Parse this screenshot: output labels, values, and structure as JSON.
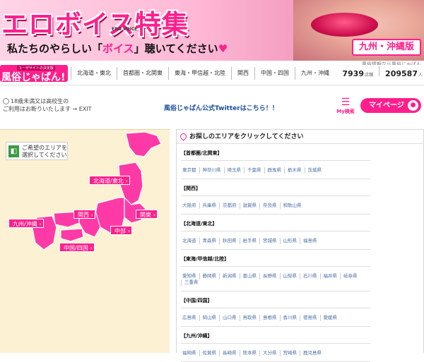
{
  "banner": {
    "title": "エロボイス特集",
    "voice_mark": "ERO VOICE",
    "subtitle_pre": "私たちのやらしい「",
    "subtitle_hl": "ボイス",
    "subtitle_post": "」聴いてください",
    "heart": "♥",
    "region": "九州・沖縄版"
  },
  "tagline": "風俗情報なら風俗じゃぱん",
  "logo": {
    "small": "ユーザサイトの決定版",
    "big": "風俗じゃぱん!"
  },
  "nav": {
    "links": [
      "北海道・東北",
      "首都圏・北関東",
      "東海・甲信越・北陸",
      "関西",
      "中国・四国",
      "九州・沖縄"
    ]
  },
  "counts": {
    "shops": "7939",
    "shops_unit": "店舗",
    "girls": "209587",
    "girls_unit": "人"
  },
  "age_note": {
    "line1": "18歳未満又は高校生の",
    "line2": "ご利用はお断りいたします → EXIT"
  },
  "twitter": "風俗じゃぱん公式Twitterはこちら！！",
  "my_search": "My検索",
  "my_page": "マイページ",
  "map": {
    "guide_line1": "ご希望のエリアを",
    "guide_line2": "選択してください",
    "labels": {
      "hokkaido": "北海道/東北",
      "kanto": "関東",
      "kansai": "関西",
      "chubu": "中部",
      "kyushu": "九州/沖縄",
      "chugoku": "中国/四国"
    }
  },
  "area_panel": {
    "heading": "お探しのエリアをクリックしてください",
    "groups": [
      {
        "title": "【首都圏/北関東】",
        "prefs": [
          "東京都",
          "神奈川県",
          "埼玉県",
          "千葉県",
          "群馬県",
          "栃木県",
          "茨城県"
        ]
      },
      {
        "title": "【関西】",
        "prefs": [
          "大阪府",
          "兵庫県",
          "京都府",
          "滋賀県",
          "奈良県",
          "和歌山県"
        ]
      },
      {
        "title": "【北海道/東北】",
        "prefs": [
          "北海道",
          "青森県",
          "秋田県",
          "岩手県",
          "宮城県",
          "山形県",
          "福島県"
        ]
      },
      {
        "title": "【東海/甲信越/北陸】",
        "prefs": [
          "愛知県",
          "静岡県",
          "新潟県",
          "富山県",
          "長野県",
          "山梨県",
          "石川県",
          "福井県",
          "岐阜県",
          "三重県"
        ]
      },
      {
        "title": "【中国/四国】",
        "prefs": [
          "広島県",
          "岡山県",
          "山口県",
          "鳥取県",
          "島根県",
          "香川県",
          "徳島県",
          "愛媛県"
        ]
      },
      {
        "title": "【九州/沖縄】",
        "prefs": [
          "福岡県",
          "佐賀県",
          "長崎県",
          "熊本県",
          "大分県",
          "宮崎県",
          "鹿児島県"
        ]
      }
    ]
  },
  "colors": {
    "accent": "#ff1f8c",
    "map_bg": "#fdf1d3",
    "link": "#4a6fa5"
  }
}
